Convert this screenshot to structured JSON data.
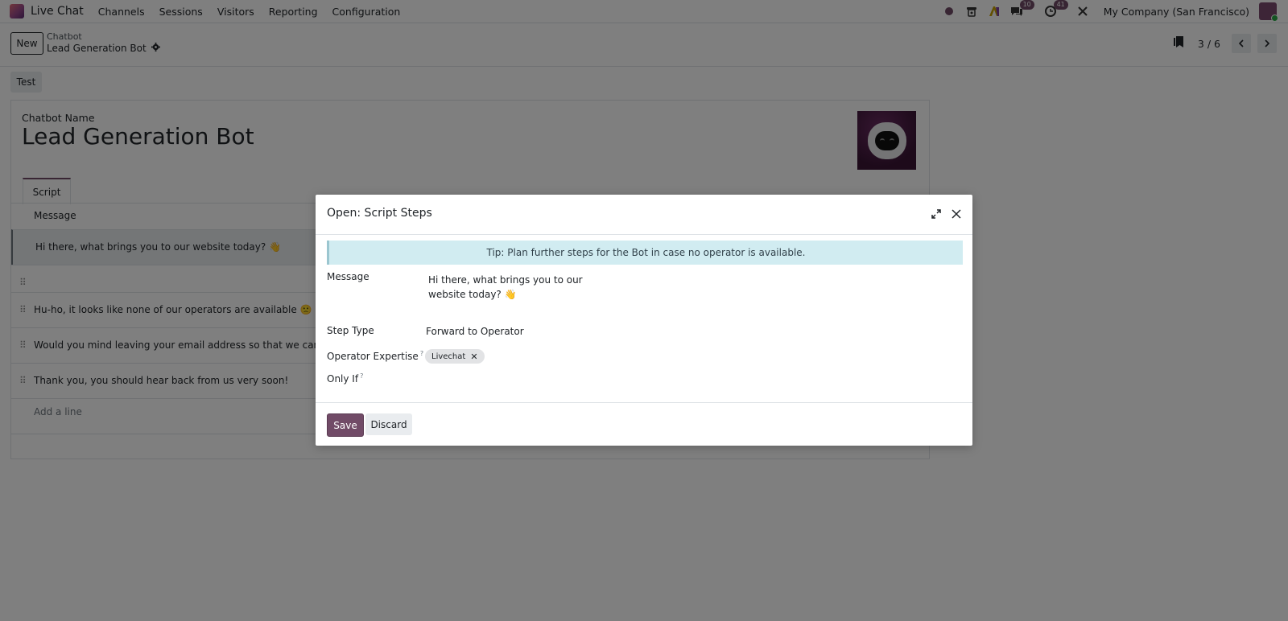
{
  "navbar": {
    "app_name": "Live Chat",
    "menu": [
      "Channels",
      "Sessions",
      "Visitors",
      "Reporting",
      "Configuration"
    ],
    "messages_badge": "10",
    "activities_badge": "41",
    "company": "My Company (San Francisco)"
  },
  "control_panel": {
    "new_label": "New",
    "breadcrumb_parent": "Chatbot",
    "breadcrumb_current": "Lead Generation Bot",
    "pager": "3 / 6"
  },
  "form": {
    "test_label": "Test",
    "name_label": "Chatbot Name",
    "name_value": "Lead Generation Bot",
    "tab_label": "Script",
    "column_header": "Message",
    "rows": [
      "Hi there, what brings you to our website today? 👋",
      "",
      "Hu-ho, it looks like none of our operators are available 🙁",
      "Would you mind leaving your email address so that we can reach yo",
      "Thank you, you should hear back from us very soon!"
    ],
    "add_line": "Add a line"
  },
  "modal": {
    "title": "Open: Script Steps",
    "tip": "Tip: Plan further steps for the Bot in case no operator is available.",
    "message_label": "Message",
    "message_value": "Hi there, what brings you to our website today? 👋",
    "step_type_label": "Step Type",
    "step_type_value": "Forward to Operator",
    "expertise_label": "Operator Expertise",
    "expertise_tag": "Livechat",
    "only_if_label": "Only If",
    "help_mark": "?",
    "save_label": "Save",
    "discard_label": "Discard"
  },
  "colors": {
    "brand": "#714b67",
    "alert_bg": "#d1ecf1",
    "backdrop": "rgba(0,0,0,0.5)"
  }
}
